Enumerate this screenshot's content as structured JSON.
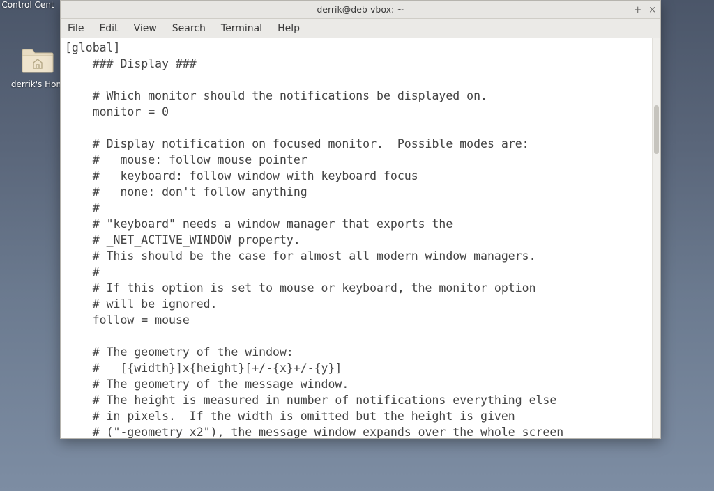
{
  "desktop": {
    "icons": [
      {
        "name": "control-center-icon",
        "label": "Control Cent"
      },
      {
        "name": "home-folder-icon",
        "label": "derrik's Hom"
      }
    ]
  },
  "window": {
    "title": "derrik@deb-vbox: ~",
    "controls": {
      "minimize": "–",
      "maximize": "+",
      "close": "×"
    },
    "menu": [
      "File",
      "Edit",
      "View",
      "Search",
      "Terminal",
      "Help"
    ],
    "terminal_lines": [
      "[global]",
      "    ### Display ###",
      "",
      "    # Which monitor should the notifications be displayed on.",
      "    monitor = 0",
      "",
      "    # Display notification on focused monitor.  Possible modes are:",
      "    #   mouse: follow mouse pointer",
      "    #   keyboard: follow window with keyboard focus",
      "    #   none: don't follow anything",
      "    #",
      "    # \"keyboard\" needs a window manager that exports the",
      "    # _NET_ACTIVE_WINDOW property.",
      "    # This should be the case for almost all modern window managers.",
      "    #",
      "    # If this option is set to mouse or keyboard, the monitor option",
      "    # will be ignored.",
      "    follow = mouse",
      "",
      "    # The geometry of the window:",
      "    #   [{width}]x{height}[+/-{x}+/-{y}]",
      "    # The geometry of the message window.",
      "    # The height is measured in number of notifications everything else",
      "    # in pixels.  If the width is omitted but the height is given",
      "    # (\"-geometry x2\"), the message window expands over the whole screen"
    ]
  }
}
